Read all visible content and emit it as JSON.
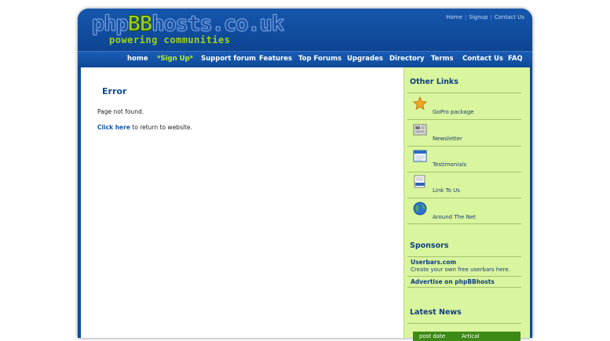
{
  "header": {
    "logo_prefix": "php",
    "logo_bb": "BB",
    "logo_suffix": "hosts.co.uk",
    "tagline": "powering communities",
    "toplinks": [
      "Home",
      "Signup",
      "Contact Us"
    ]
  },
  "nav": [
    {
      "label": "home",
      "highlight": false
    },
    {
      "label": "*Sign Up*",
      "highlight": true
    },
    {
      "label": "Support forum",
      "highlight": false
    },
    {
      "label": "Features",
      "highlight": false
    },
    {
      "label": "Top Forums",
      "highlight": false
    },
    {
      "label": "Upgrades",
      "highlight": false
    },
    {
      "label": "Directory",
      "highlight": false
    },
    {
      "label": "Terms",
      "highlight": false
    },
    {
      "label": "Contact Us",
      "highlight": false
    },
    {
      "label": "FAQ",
      "highlight": false
    }
  ],
  "main": {
    "title": "Error",
    "message": "Page not found.",
    "return_link": "Click here",
    "return_text": " to return to website."
  },
  "sidebar": {
    "other_links_title": "Other Links",
    "links": [
      {
        "label": "GoPro package",
        "icon": "star-icon"
      },
      {
        "label": "Newsletter",
        "icon": "newsletter-icon"
      },
      {
        "label": "Testimonials",
        "icon": "calendar-icon"
      },
      {
        "label": "Link To Us",
        "icon": "document-link-icon"
      },
      {
        "label": "Around The Net",
        "icon": "globe-icon"
      }
    ],
    "sponsors_title": "Sponsors",
    "sponsors": [
      {
        "name": "Userbars.com",
        "desc": "Create your own free userbars here."
      },
      {
        "name": "Advertise on phpBBhosts",
        "desc": ""
      }
    ],
    "news_title": "Latest News",
    "news_headers": [
      "post date",
      "Artical"
    ]
  },
  "colors": {
    "frame_blue": "#0f4a96",
    "sidebar_green": "#d9f59e",
    "accent_lime": "#9fd21a",
    "news_header_green": "#3e8a17"
  }
}
